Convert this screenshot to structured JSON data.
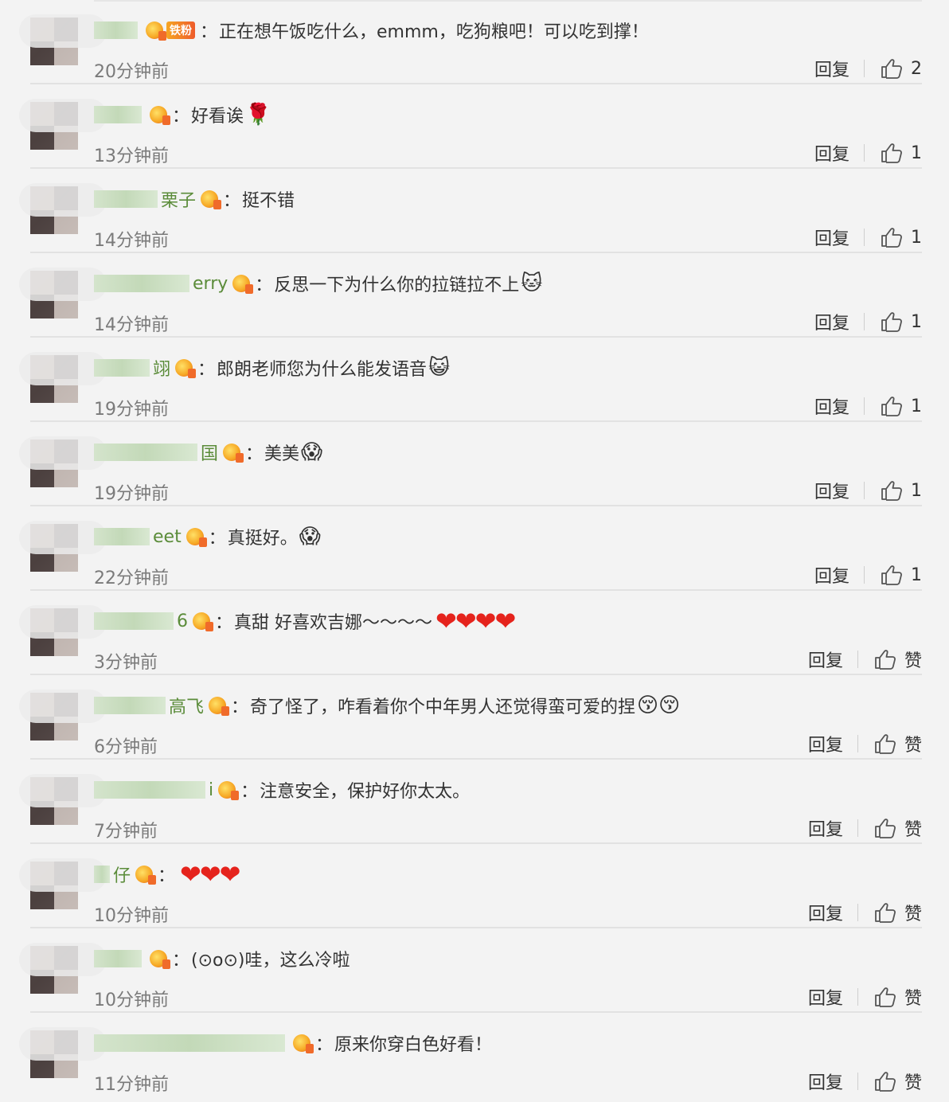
{
  "comments": [
    {
      "user_suffix": "",
      "badge_text": "铁粉",
      "text": "正在想午饭吃什么，emmm，吃狗粮吧！可以吃到撑！",
      "emoji": "",
      "hearts": "",
      "time": "20分钟前",
      "reply": "回复",
      "likes": "2"
    },
    {
      "user_suffix": "",
      "badge_text": "",
      "text": "好看诶",
      "emoji": "🌹",
      "hearts": "",
      "time": "13分钟前",
      "reply": "回复",
      "likes": "1"
    },
    {
      "user_suffix": "栗子",
      "badge_text": "",
      "text": "挺不错",
      "emoji": "",
      "hearts": "",
      "time": "14分钟前",
      "reply": "回复",
      "likes": "1"
    },
    {
      "user_suffix": "erry",
      "badge_text": "",
      "text": "反思一下为什么你的拉链拉不上",
      "emoji": "🐱",
      "hearts": "",
      "time": "14分钟前",
      "reply": "回复",
      "likes": "1"
    },
    {
      "user_suffix": "翊",
      "badge_text": "",
      "text": "郎朗老师您为什么能发语音",
      "emoji": "😺",
      "hearts": "",
      "time": "19分钟前",
      "reply": "回复",
      "likes": "1"
    },
    {
      "user_suffix": "国",
      "badge_text": "",
      "text": "美美",
      "emoji": "😱",
      "hearts": "",
      "time": "19分钟前",
      "reply": "回复",
      "likes": "1"
    },
    {
      "user_suffix": "eet",
      "badge_text": "",
      "text": "真挺好。",
      "emoji": "😱",
      "hearts": "",
      "time": "22分钟前",
      "reply": "回复",
      "likes": "1"
    },
    {
      "user_suffix": "6",
      "badge_text": "",
      "text": "真甜 好喜欢吉娜～～～～",
      "emoji": "",
      "hearts": "❤❤❤❤",
      "time": "3分钟前",
      "reply": "回复",
      "likes": "赞"
    },
    {
      "user_suffix": "高飞",
      "badge_text": "",
      "text": "奇了怪了，咋看着你个中年男人还觉得蛮可爱的捏",
      "emoji": "😚😚",
      "hearts": "",
      "time": "6分钟前",
      "reply": "回复",
      "likes": "赞"
    },
    {
      "user_suffix": "i",
      "badge_text": "",
      "text": "注意安全，保护好你太太。",
      "emoji": "",
      "hearts": "",
      "time": "7分钟前",
      "reply": "回复",
      "likes": "赞"
    },
    {
      "user_suffix": "仔",
      "badge_text": "",
      "text": "",
      "emoji": "",
      "hearts": "❤❤❤",
      "time": "10分钟前",
      "reply": "回复",
      "likes": "赞"
    },
    {
      "user_suffix": "",
      "badge_text": "",
      "text": "(⊙o⊙)哇，这么冷啦",
      "emoji": "",
      "hearts": "",
      "time": "10分钟前",
      "reply": "回复",
      "likes": "赞"
    },
    {
      "user_suffix": "",
      "badge_text": "",
      "text": "原来你穿白色好看！",
      "emoji": "",
      "hearts": "",
      "time": "11分钟前",
      "reply": "回复",
      "likes": "赞"
    }
  ],
  "icons": {
    "like": "thumbs-up-icon",
    "fan_badge": "fan-crown-icon"
  },
  "colors": {
    "username": "#5b8c3a",
    "heart": "#e5231c",
    "time": "#7a7a7a"
  }
}
